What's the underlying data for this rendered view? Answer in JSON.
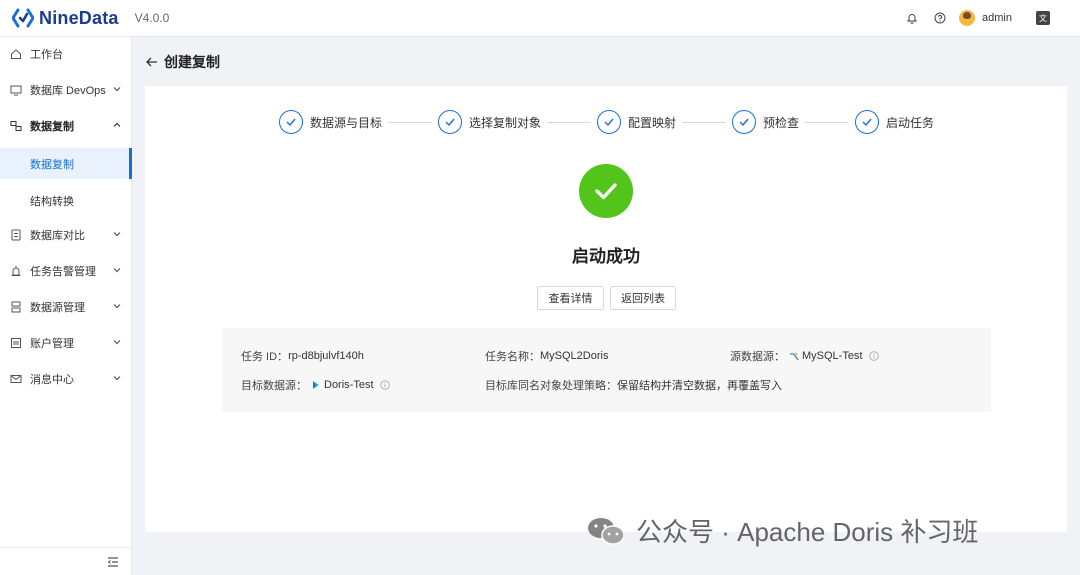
{
  "app": {
    "name": "NineData",
    "version": "V4.0.0"
  },
  "user": {
    "name": "admin"
  },
  "sidebar": {
    "items": [
      {
        "label": "工作台"
      },
      {
        "label": "数据库 DevOps"
      },
      {
        "label": "数据复制"
      },
      {
        "label": "数据库对比"
      },
      {
        "label": "任务告警管理"
      },
      {
        "label": "数据源管理"
      },
      {
        "label": "账户管理"
      },
      {
        "label": "消息中心"
      }
    ],
    "sub_items": [
      {
        "label": "数据复制",
        "active": true
      },
      {
        "label": "结构转换",
        "active": false
      }
    ]
  },
  "page": {
    "title": "创建复制"
  },
  "steps": [
    {
      "label": "数据源与目标",
      "done": true
    },
    {
      "label": "选择复制对象",
      "done": true
    },
    {
      "label": "配置映射",
      "done": true
    },
    {
      "label": "预检查",
      "done": true
    },
    {
      "label": "启动任务",
      "done": true
    }
  ],
  "result": {
    "title": "启动成功",
    "view_details_label": "查看详情",
    "back_to_list_label": "返回列表"
  },
  "task_info": {
    "id_label": "任务 ID：",
    "id_value": "rp-d8bjulvf140h",
    "name_label": "任务名称：",
    "name_value": "MySQL2Doris",
    "source_label": "源数据源：",
    "source_value": "MySQL-Test",
    "target_label": "目标数据源：",
    "target_value": "Doris-Test",
    "strategy_label": "目标库同名对象处理策略：",
    "strategy_value": "保留结构并清空数据，再覆盖写入"
  },
  "watermark": {
    "text": "公众号 · Apache Doris 补习班"
  },
  "colors": {
    "primary": "#1a6fd6",
    "success": "#52c41a",
    "brand": "#1a3d8f"
  }
}
